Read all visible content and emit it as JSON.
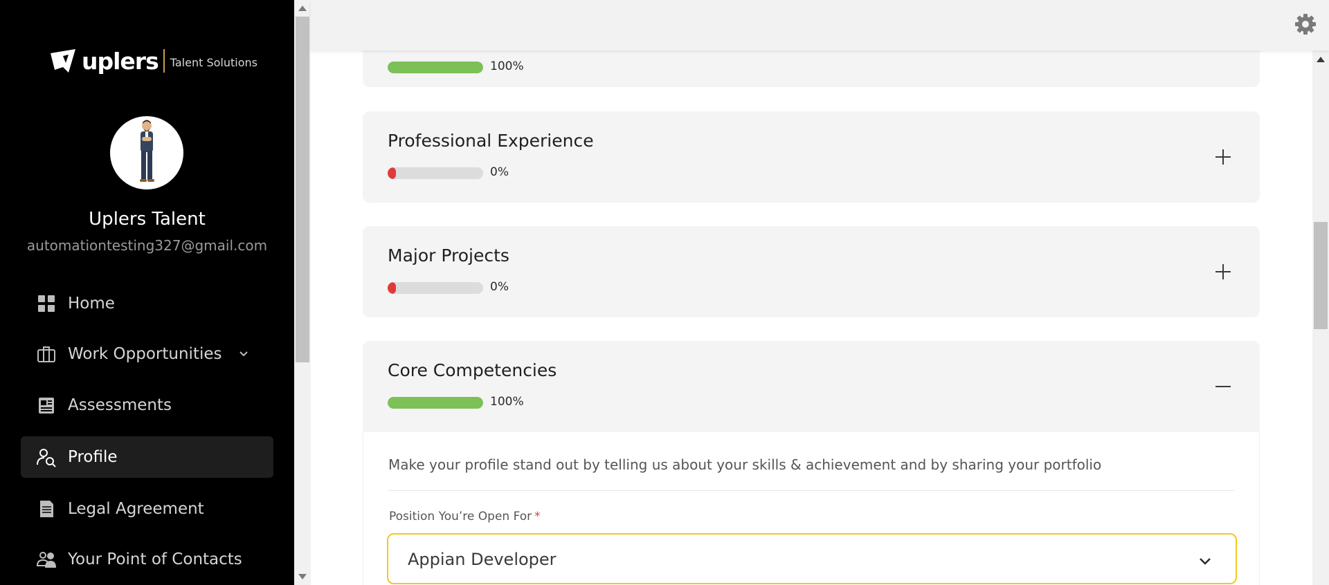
{
  "brand": {
    "name": "uplers",
    "tagline": "Talent Solutions"
  },
  "user": {
    "name": "Uplers Talent",
    "email": "automationtesting327@gmail.com"
  },
  "nav": [
    {
      "label": "Home",
      "icon": "grid-icon"
    },
    {
      "label": "Work Opportunities",
      "icon": "briefcase-icon",
      "has_dropdown": true
    },
    {
      "label": "Assessments",
      "icon": "assessment-icon"
    },
    {
      "label": "Profile",
      "icon": "profile-search-icon",
      "active": true
    },
    {
      "label": "Legal Agreement",
      "icon": "document-icon"
    },
    {
      "label": "Your Point of Contacts",
      "icon": "contacts-icon"
    }
  ],
  "sections": [
    {
      "title": "",
      "progress_label": "100%",
      "progress": 1.0
    },
    {
      "title": "Professional Experience",
      "progress_label": "0%",
      "progress": 0.0
    },
    {
      "title": "Major Projects",
      "progress_label": "0%",
      "progress": 0.0
    },
    {
      "title": "Core Competencies",
      "progress_label": "100%",
      "progress": 1.0,
      "expanded": true
    }
  ],
  "core_competencies": {
    "description": "Make your profile stand out by telling us about your skills & achievement and by sharing your portfolio",
    "position_label": "Position You’re Open For",
    "required_mark": "*",
    "position_value": "Appian Developer"
  },
  "colors": {
    "progress_full": "#7cc057",
    "progress_empty": "#e03a3a",
    "focus_border": "#f2c81b"
  }
}
